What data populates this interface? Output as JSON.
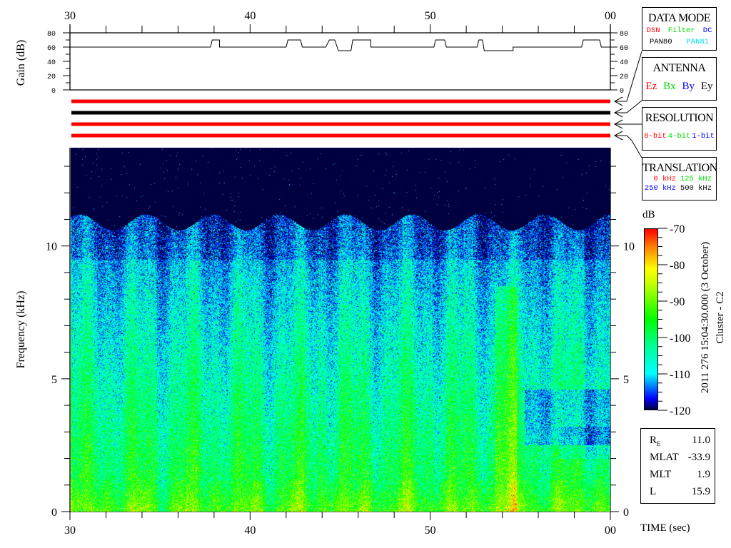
{
  "chart_data": {
    "type": "heatmap",
    "title": "",
    "xlabel": "TIME (sec)",
    "ylabel": "Frequency (kHz)",
    "xlim": [
      30,
      60
    ],
    "ylim": [
      0,
      13.7
    ],
    "x_ticks": [
      {
        "value": 30,
        "label": "30"
      },
      {
        "value": 40,
        "label": "40"
      },
      {
        "value": 50,
        "label": "50"
      },
      {
        "value": 60,
        "label": "00"
      }
    ],
    "y_ticks": [
      {
        "value": 0,
        "label": "0"
      },
      {
        "value": 5,
        "label": "5"
      },
      {
        "value": 10,
        "label": "10"
      }
    ],
    "colorbar": {
      "label": "dB",
      "range": [
        -120,
        -70
      ],
      "ticks": [
        "-70",
        "-80",
        "-90",
        "-100",
        "-110",
        "-120"
      ],
      "colormap": [
        {
          "db": -120,
          "color": "#000040"
        },
        {
          "db": -117,
          "color": "#0000ff"
        },
        {
          "db": -110,
          "color": "#00ffff"
        },
        {
          "db": -102,
          "color": "#00ff90"
        },
        {
          "db": -95,
          "color": "#00ff00"
        },
        {
          "db": -85,
          "color": "#c8ff00"
        },
        {
          "db": -81,
          "color": "#ffff00"
        },
        {
          "db": -75,
          "color": "#ff8000"
        },
        {
          "db": -70,
          "color": "#ff0000"
        }
      ]
    },
    "gain_panel": {
      "ylabel": "Gain (dB)",
      "ylim": [
        0,
        80
      ],
      "y_ticks": [
        "0",
        "20",
        "40",
        "60",
        "80"
      ],
      "segments": [
        [
          30,
          37.8,
          60
        ],
        [
          37.9,
          38.3,
          70
        ],
        [
          38.3,
          42.0,
          60
        ],
        [
          42.1,
          42.8,
          70
        ],
        [
          42.9,
          44.2,
          60
        ],
        [
          44.4,
          44.7,
          70
        ],
        [
          44.9,
          45.6,
          55
        ],
        [
          45.7,
          46.7,
          70
        ],
        [
          46.7,
          50.2,
          60
        ],
        [
          50.3,
          50.8,
          70
        ],
        [
          50.9,
          52.6,
          60
        ],
        [
          52.7,
          52.9,
          70
        ],
        [
          53.0,
          54.6,
          55
        ],
        [
          54.6,
          58.4,
          60
        ],
        [
          58.5,
          59.4,
          70
        ],
        [
          59.5,
          60,
          60
        ]
      ]
    },
    "status_bars": [
      {
        "color": "#ff0000"
      },
      {
        "color": "#000000"
      },
      {
        "color": "#ff0000"
      },
      {
        "color": "#ff0000"
      }
    ]
  },
  "side_text": {
    "timestamp": "2011 276 15:04:30.000 (3 October)",
    "spacecraft": "Cluster - C2"
  },
  "legends": {
    "data_mode": {
      "title": "DATA MODE",
      "items": [
        {
          "text": "DSN",
          "color": "#ff0000"
        },
        {
          "text": "Filter",
          "color": "#00dd00"
        },
        {
          "text": "DC",
          "color": "#0000ff"
        },
        {
          "text": "PAN80",
          "color": "#000000"
        },
        {
          "text": "PAN81",
          "color": "#00e0e0"
        }
      ]
    },
    "antenna": {
      "title": "ANTENNA",
      "items": [
        {
          "text": "Ez",
          "color": "#ff0000"
        },
        {
          "text": "Bx",
          "color": "#00dd00"
        },
        {
          "text": "By",
          "color": "#0000ff"
        },
        {
          "text": "Ey",
          "color": "#000000"
        }
      ]
    },
    "resolution": {
      "title": "RESOLUTION",
      "items": [
        {
          "text": "8-bit",
          "color": "#ff0000"
        },
        {
          "text": "4-bit",
          "color": "#00dd00"
        },
        {
          "text": "1-bit",
          "color": "#0000ff"
        }
      ]
    },
    "translation": {
      "title": "TRANSLATION",
      "items": [
        {
          "text": "0 kHz",
          "color": "#ff0000"
        },
        {
          "text": "125 kHz",
          "color": "#00dd00"
        },
        {
          "text": "250 kHz",
          "color": "#0000ff"
        },
        {
          "text": "500 kHz",
          "color": "#000000"
        }
      ]
    }
  },
  "position": {
    "re": {
      "label": "R",
      "sub": "E",
      "value": "11.0"
    },
    "mlat": {
      "label": "MLAT",
      "value": "-33.9"
    },
    "mlt": {
      "label": "MLT",
      "value": "1.9"
    },
    "l": {
      "label": "L",
      "value": "15.9"
    }
  }
}
